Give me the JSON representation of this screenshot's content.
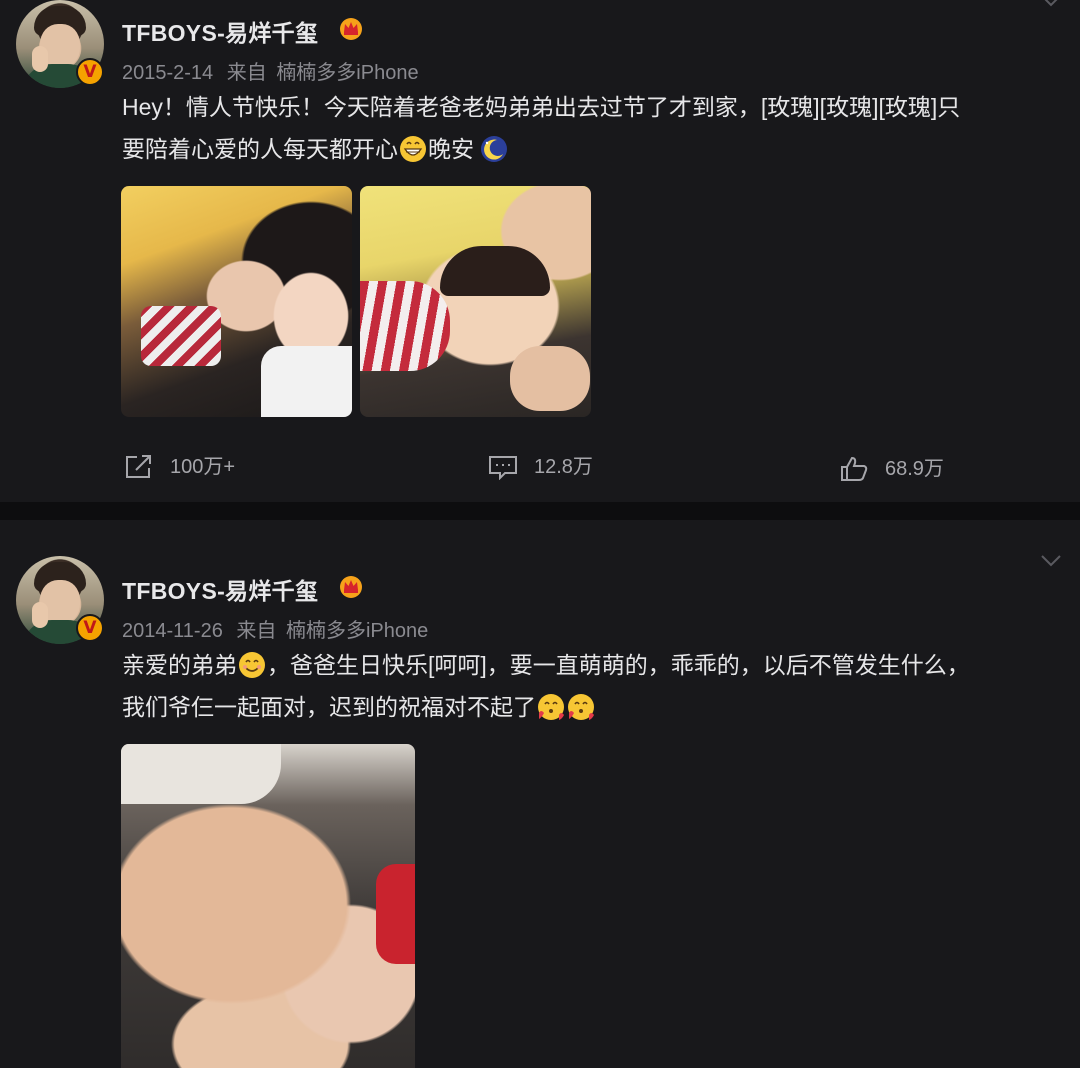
{
  "posts": [
    {
      "username": "TFBOYS-易烊千玺",
      "date": "2015-2-14",
      "source_prefix": "来自",
      "source": "楠楠多多iPhone",
      "text_line1": "Hey！情人节快乐！今天陪着老爸老妈弟弟出去过节了才到家，[玫瑰][玫瑰][玫瑰]只",
      "text_line2_a": "要陪着心爱的人每天都开心",
      "text_line2_b": "晚安",
      "emojis": [
        "grin-emoji",
        "moon-emoji"
      ],
      "actions": {
        "repost": "100万+",
        "comment": "12.8万",
        "like": "68.9万"
      }
    },
    {
      "username": "TFBOYS-易烊千玺",
      "date": "2014-11-26",
      "source_prefix": "来自",
      "source": "楠楠多多iPhone",
      "text_line1_a": "亲爱的弟弟",
      "text_line1_b": "，爸爸生日快乐[呵呵]，要一直萌萌的，乖乖的，以后不管发生什么，",
      "text_line2": "我们爷仨一起面对，迟到的祝福对不起了",
      "emojis": [
        "smile-emoji",
        "heart-face-emoji",
        "heart-face-emoji"
      ]
    }
  ],
  "colors": {
    "background": "#18181b",
    "badge": "#f5a200",
    "text": "#e6e6e8",
    "muted": "#8a8a90"
  }
}
